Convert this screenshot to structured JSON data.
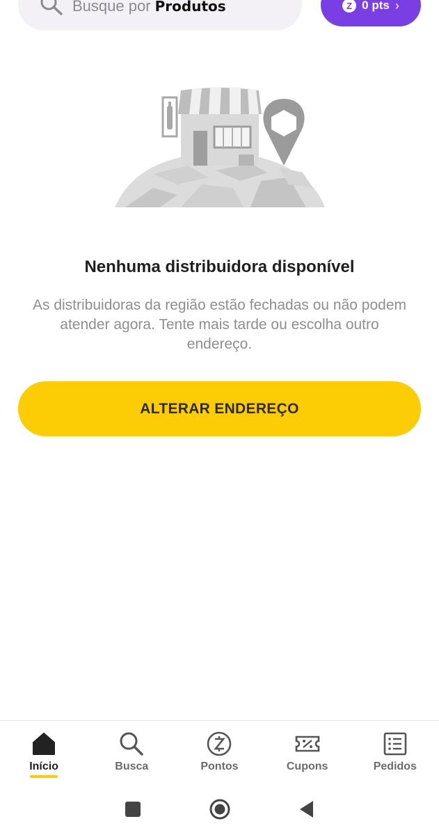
{
  "search": {
    "placeholder_prefix": "Busque por ",
    "placeholder_emphasis": "Produtos"
  },
  "points": {
    "badge": "Z",
    "label": "0 pts",
    "chevron": "›",
    "color": "#7a3fe4"
  },
  "empty_state": {
    "illustration_icon": "store-map-pin-illustration",
    "title": "Nenhuma distribuidora disponível",
    "description": "As distribuidoras da região estão fechadas ou não podem atender agora. Tente mais tarde ou escolha outro endereço.",
    "button_label": "ALTERAR ENDEREÇO",
    "button_color": "#fccd04"
  },
  "bottom_nav": {
    "items": [
      {
        "label": "Início",
        "icon": "home-icon",
        "active": true
      },
      {
        "label": "Busca",
        "icon": "search-icon",
        "active": false
      },
      {
        "label": "Pontos",
        "icon": "points-icon",
        "active": false
      },
      {
        "label": "Cupons",
        "icon": "coupon-icon",
        "active": false
      },
      {
        "label": "Pedidos",
        "icon": "orders-icon",
        "active": false
      }
    ],
    "accent": "#fccd04"
  },
  "system_nav": {
    "icons": [
      "recents-icon",
      "home-circle-icon",
      "back-icon"
    ]
  }
}
